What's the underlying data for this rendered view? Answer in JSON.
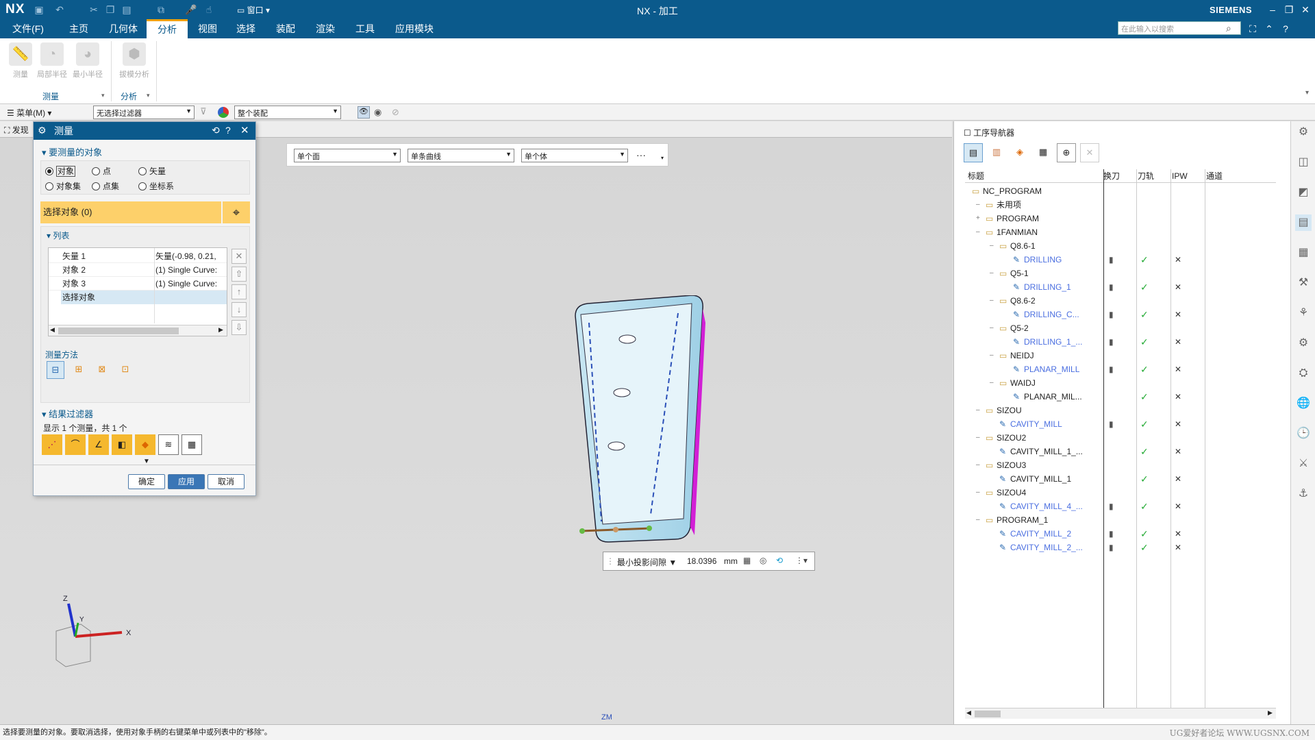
{
  "titlebar": {
    "logo": "NX",
    "title": "NX - 加工",
    "brand": "SIEMENS",
    "window_menu": "窗口"
  },
  "menu": {
    "items": [
      "文件(F)",
      "主页",
      "几何体",
      "分析",
      "视图",
      "选择",
      "装配",
      "渲染",
      "工具",
      "应用模块"
    ],
    "search_placeholder": "在此输入以搜索"
  },
  "ribbon": {
    "buttons": [
      {
        "label": "测量",
        "icon": "ruler-icon"
      },
      {
        "label": "局部半径",
        "icon": "radius-icon"
      },
      {
        "label": "最小半径",
        "icon": "min-radius-icon"
      },
      {
        "label": "拔模分析",
        "icon": "draft-analysis-icon"
      }
    ],
    "groups": [
      "测量",
      "分析"
    ]
  },
  "selbar": {
    "menu": "菜单(M)",
    "filter": "无选择过滤器",
    "scope": "整个装配"
  },
  "tab": {
    "label": "发现"
  },
  "viewport_toolbar": {
    "face": "单个面",
    "curve": "单条曲线",
    "body": "单个体"
  },
  "dialog": {
    "title": "测量",
    "section_objects": "要测量的对象",
    "radios": [
      {
        "label": "对象",
        "checked": true
      },
      {
        "label": "点",
        "checked": false
      },
      {
        "label": "矢量",
        "checked": false
      },
      {
        "label": "对象集",
        "checked": false
      },
      {
        "label": "点集",
        "checked": false
      },
      {
        "label": "坐标系",
        "checked": false
      }
    ],
    "select_objects": "选择对象 (0)",
    "list_title": "列表",
    "list": [
      {
        "name": "矢量 1",
        "value": "矢量(-0.98, 0.21, "
      },
      {
        "name": "对象 2",
        "value": "(1) Single Curve:"
      },
      {
        "name": "对象 3",
        "value": "(1) Single Curve:"
      },
      {
        "name": "选择对象",
        "value": ""
      }
    ],
    "method_title": "测量方法",
    "filter_title": "结果过滤器",
    "filter_text": "显示 1 个测量，共 1 个",
    "ok": "确定",
    "apply": "应用",
    "cancel": "取消"
  },
  "measure_popup": {
    "type": "最小投影间隙",
    "value": "18.0396",
    "unit": "mm"
  },
  "axes": {
    "x": "X",
    "y": "Y",
    "z": "Z"
  },
  "zm": "ZM",
  "navigator": {
    "title": "工序导航器",
    "columns": [
      "标题",
      "换刀",
      "刀轨",
      "IPW",
      "通道"
    ],
    "rows": [
      {
        "level": 0,
        "name": "NC_PROGRAM",
        "kind": "root",
        "blue": false,
        "tool": false,
        "path": false,
        "ipw": false
      },
      {
        "level": 1,
        "name": "未用项",
        "kind": "folder",
        "blue": false,
        "tool": false,
        "path": false,
        "ipw": false
      },
      {
        "level": 1,
        "name": "PROGRAM",
        "kind": "folder",
        "blue": false,
        "tool": false,
        "path": false,
        "ipw": false
      },
      {
        "level": 1,
        "name": "1FANMIAN",
        "kind": "folder",
        "blue": false,
        "tool": false,
        "path": false,
        "ipw": false
      },
      {
        "level": 2,
        "name": "Q8.6-1",
        "kind": "folder",
        "blue": false,
        "tool": false,
        "path": false,
        "ipw": false
      },
      {
        "level": 3,
        "name": "DRILLING",
        "kind": "op",
        "blue": true,
        "tool": true,
        "path": true,
        "ipw": true
      },
      {
        "level": 2,
        "name": "Q5-1",
        "kind": "folder",
        "blue": false,
        "tool": false,
        "path": false,
        "ipw": false
      },
      {
        "level": 3,
        "name": "DRILLING_1",
        "kind": "op",
        "blue": true,
        "tool": true,
        "path": true,
        "ipw": true
      },
      {
        "level": 2,
        "name": "Q8.6-2",
        "kind": "folder",
        "blue": false,
        "tool": false,
        "path": false,
        "ipw": false
      },
      {
        "level": 3,
        "name": "DRILLING_C...",
        "kind": "op",
        "blue": true,
        "tool": true,
        "path": true,
        "ipw": true
      },
      {
        "level": 2,
        "name": "Q5-2",
        "kind": "folder",
        "blue": false,
        "tool": false,
        "path": false,
        "ipw": false
      },
      {
        "level": 3,
        "name": "DRILLING_1_...",
        "kind": "op",
        "blue": true,
        "tool": true,
        "path": true,
        "ipw": true
      },
      {
        "level": 2,
        "name": "NEIDJ",
        "kind": "folder",
        "blue": false,
        "tool": false,
        "path": false,
        "ipw": false
      },
      {
        "level": 3,
        "name": "PLANAR_MILL",
        "kind": "op",
        "blue": true,
        "tool": true,
        "path": true,
        "ipw": true
      },
      {
        "level": 2,
        "name": "WAIDJ",
        "kind": "folder",
        "blue": false,
        "tool": false,
        "path": false,
        "ipw": false
      },
      {
        "level": 3,
        "name": "PLANAR_MIL...",
        "kind": "op",
        "blue": false,
        "tool": false,
        "path": true,
        "ipw": true
      },
      {
        "level": 1,
        "name": "SIZOU",
        "kind": "folder",
        "blue": false,
        "tool": false,
        "path": false,
        "ipw": false
      },
      {
        "level": 2,
        "name": "CAVITY_MILL",
        "kind": "op",
        "blue": true,
        "tool": true,
        "path": true,
        "ipw": true
      },
      {
        "level": 1,
        "name": "SIZOU2",
        "kind": "folder",
        "blue": false,
        "tool": false,
        "path": false,
        "ipw": false
      },
      {
        "level": 2,
        "name": "CAVITY_MILL_1_...",
        "kind": "op",
        "blue": false,
        "tool": false,
        "path": true,
        "ipw": true
      },
      {
        "level": 1,
        "name": "SIZOU3",
        "kind": "folder",
        "blue": false,
        "tool": false,
        "path": false,
        "ipw": false
      },
      {
        "level": 2,
        "name": "CAVITY_MILL_1",
        "kind": "op",
        "blue": false,
        "tool": false,
        "path": true,
        "ipw": true
      },
      {
        "level": 1,
        "name": "SIZOU4",
        "kind": "folder",
        "blue": false,
        "tool": false,
        "path": false,
        "ipw": false
      },
      {
        "level": 2,
        "name": "CAVITY_MILL_4_...",
        "kind": "op",
        "blue": true,
        "tool": true,
        "path": true,
        "ipw": true
      },
      {
        "level": 1,
        "name": "PROGRAM_1",
        "kind": "folder",
        "blue": false,
        "tool": false,
        "path": false,
        "ipw": false
      },
      {
        "level": 2,
        "name": "CAVITY_MILL_2",
        "kind": "op",
        "blue": true,
        "tool": true,
        "path": true,
        "ipw": true
      },
      {
        "level": 2,
        "name": "CAVITY_MILL_2_...",
        "kind": "op",
        "blue": true,
        "tool": true,
        "path": true,
        "ipw": true
      }
    ]
  },
  "status": "选择要测量的对象。要取消选择，使用对象手柄的右键菜单中或列表中的\"移除\"。",
  "watermark": "UG爱好者论坛 WWW.UGSNX.COM",
  "colors": {
    "primary": "#0b5a8c",
    "highlight": "#fdd06a",
    "check": "#22aa33",
    "op_link": "#4a6ee0"
  }
}
